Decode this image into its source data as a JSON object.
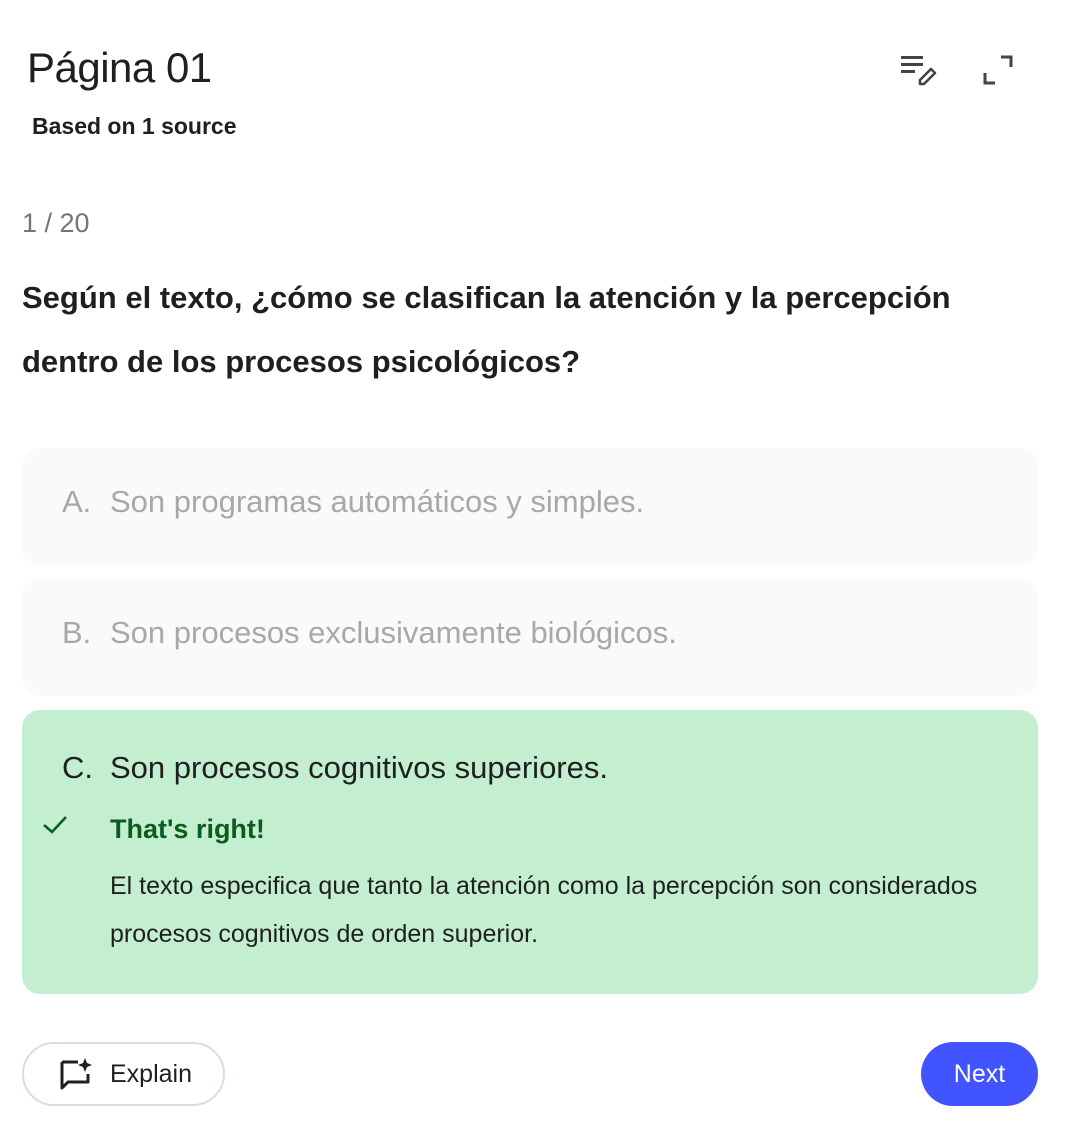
{
  "header": {
    "title": "Página 01",
    "subtitle": "Based on 1 source",
    "icons": [
      "edit-list-icon",
      "fullscreen-icon"
    ]
  },
  "quiz": {
    "counter": "1 / 20",
    "question": "Según el texto, ¿cómo se clasifican la atención y la percepción dentro de los procesos psicológicos?",
    "options": [
      {
        "letter": "A.",
        "text": "Son programas automáticos y simples."
      },
      {
        "letter": "B.",
        "text": "Son procesos exclusivamente biológicos."
      },
      {
        "letter": "C.",
        "text": "Son procesos cognitivos superiores."
      }
    ],
    "feedback": {
      "title": "That's right!",
      "body": "El texto especifica que tanto la atención como la percepción son considerados procesos cognitivos de orden superior."
    }
  },
  "footer": {
    "explain_label": "Explain",
    "next_label": "Next"
  },
  "colors": {
    "correct_bg": "#c4eed0",
    "correct_text": "#0b5d1e",
    "primary": "#4254ff"
  }
}
